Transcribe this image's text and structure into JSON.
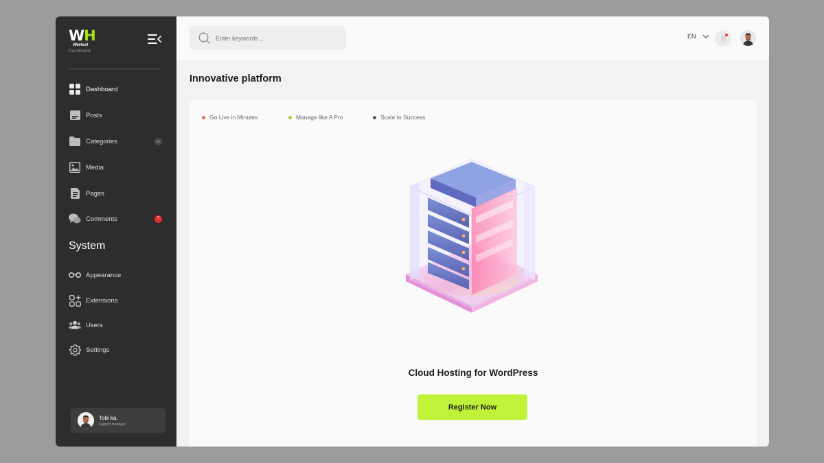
{
  "brand": {
    "logo_letters": "WH",
    "name": "WeHost",
    "subtitle": "Dashboard"
  },
  "sidebar": {
    "items": [
      {
        "label": "Dashboard",
        "icon": "dashboard-grid-icon",
        "active": true
      },
      {
        "label": "Posts",
        "icon": "posts-icon"
      },
      {
        "label": "Categories",
        "icon": "folder-icon",
        "has_submenu": true
      },
      {
        "label": "Media",
        "icon": "image-icon"
      },
      {
        "label": "Pages",
        "icon": "page-icon"
      },
      {
        "label": "Comments",
        "icon": "comments-icon",
        "badge": "7"
      }
    ],
    "system_title": "System",
    "system_items": [
      {
        "label": "Appearance",
        "icon": "glasses-icon"
      },
      {
        "label": "Extensions",
        "icon": "extensions-icon"
      },
      {
        "label": "Users",
        "icon": "users-icon"
      },
      {
        "label": "Settings",
        "icon": "gear-icon"
      }
    ],
    "user": {
      "name": "Tobi ka.",
      "role": "Support manager"
    }
  },
  "topbar": {
    "search_placeholder": "Enter keywords ...",
    "language": "EN"
  },
  "main": {
    "title": "Innovative platform",
    "features": [
      {
        "label": "Go Live in Minutes",
        "color": "#e0733a"
      },
      {
        "label": "Manage like A Pro",
        "color": "#a8cf2e"
      },
      {
        "label": "Scale to Success",
        "color": "#555555"
      }
    ],
    "hero_title": "Cloud Hosting for WordPress",
    "cta_label": "Register Now"
  },
  "colors": {
    "sidebar_bg": "#2d2d2d",
    "accent": "#c0f23a",
    "badge": "#e0302c"
  }
}
